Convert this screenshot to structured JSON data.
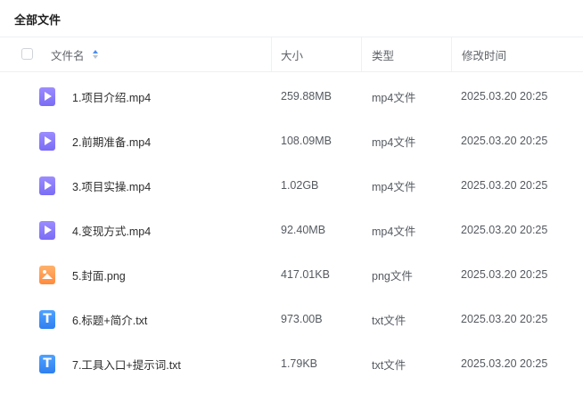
{
  "breadcrumb": "全部文件",
  "header": {
    "name": "文件名",
    "size": "大小",
    "type": "类型",
    "modified": "修改时间"
  },
  "files": [
    {
      "icon": "video-file-icon",
      "kind": "video",
      "name": "1.项目介绍.mp4",
      "size": "259.88MB",
      "type": "mp4文件",
      "modified": "2025.03.20 20:25"
    },
    {
      "icon": "video-file-icon",
      "kind": "video",
      "name": "2.前期准备.mp4",
      "size": "108.09MB",
      "type": "mp4文件",
      "modified": "2025.03.20 20:25"
    },
    {
      "icon": "video-file-icon",
      "kind": "video",
      "name": "3.项目实操.mp4",
      "size": "1.02GB",
      "type": "mp4文件",
      "modified": "2025.03.20 20:25"
    },
    {
      "icon": "video-file-icon",
      "kind": "video",
      "name": "4.变现方式.mp4",
      "size": "92.40MB",
      "type": "mp4文件",
      "modified": "2025.03.20 20:25"
    },
    {
      "icon": "image-file-icon",
      "kind": "image",
      "name": "5.封面.png",
      "size": "417.01KB",
      "type": "png文件",
      "modified": "2025.03.20 20:25"
    },
    {
      "icon": "text-file-icon",
      "kind": "text",
      "name": "6.标题+简介.txt",
      "size": "973.00B",
      "type": "txt文件",
      "modified": "2025.03.20 20:25"
    },
    {
      "icon": "text-file-icon",
      "kind": "text",
      "name": "7.工具入口+提示词.txt",
      "size": "1.79KB",
      "type": "txt文件",
      "modified": "2025.03.20 20:25"
    }
  ]
}
